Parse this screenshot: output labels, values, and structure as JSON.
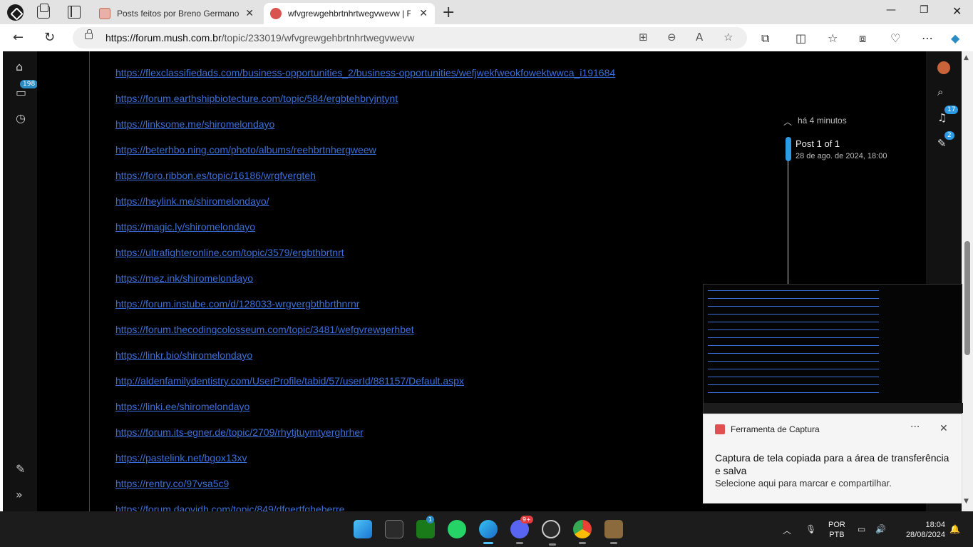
{
  "browser": {
    "tabs": [
      {
        "title": "Posts feitos por Breno Germano | "
      },
      {
        "title": "wfvgrewgehbrtnhrtwegvwevw | Fo"
      }
    ],
    "address": {
      "host": "https://forum.mush.com.br",
      "path": "/topic/233019/wfvgrewgehbrtnhrtwegvwevw"
    }
  },
  "leftbar": {
    "badge": "198"
  },
  "post": {
    "links": [
      "https://flexclassifiedads.com/business-opportunities_2/business-opportunities/wefjwekfweokfowektwwca_i191684",
      "https://forum.earthshipbiotecture.com/topic/584/ergbtehbryjntynt",
      "https://linksome.me/shiromelondayo",
      "https://beterhbo.ning.com/photo/albums/reehbrtnhergweew",
      "https://foro.ribbon.es/topic/16186/wrgfvergteh",
      "https://heylink.me/shiromelondayo/",
      "https://magic.ly/shiromelondayo",
      "https://ultrafighteronline.com/topic/3579/ergbthbrtnrt",
      "https://mez.ink/shiromelondayo",
      "https://forum.instube.com/d/128033-wrgvergbthbrthnrnr",
      "https://forum.thecodingcolosseum.com/topic/3481/wefgvrewgerhbet",
      "https://linkr.bio/shiromelondayo",
      "http://aldenfamilydentistry.com/UserProfile/tabid/57/userId/881157/Default.aspx",
      "https://linki.ee/shiromelondayo",
      "https://forum.its-egner.de/topic/2709/rhytjtuymtyerghrher",
      "https://pastelink.net/bgox13xv",
      "https://rentry.co/97vsa5c9",
      "https://forum.daovidh.com/topic/849/dfgertfgheberre"
    ]
  },
  "timeline": {
    "ago": "há 4 minutos",
    "count": "Post 1 of 1",
    "date": "28 de ago. de 2024, 18:00"
  },
  "rightnav": {
    "notifications_badge": "17",
    "drafts_badge": "2"
  },
  "toast": {
    "app": "Ferramenta de Captura",
    "title": "Captura de tela copiada para a área de transferência e salva",
    "body": "Selecione aqui para marcar e compartilhar."
  },
  "taskbar": {
    "xbox_badge": "1",
    "discord_badge": "9+",
    "lang_line1": "POR",
    "lang_line2": "PTB",
    "time": "18:04",
    "date": "28/08/2024"
  }
}
